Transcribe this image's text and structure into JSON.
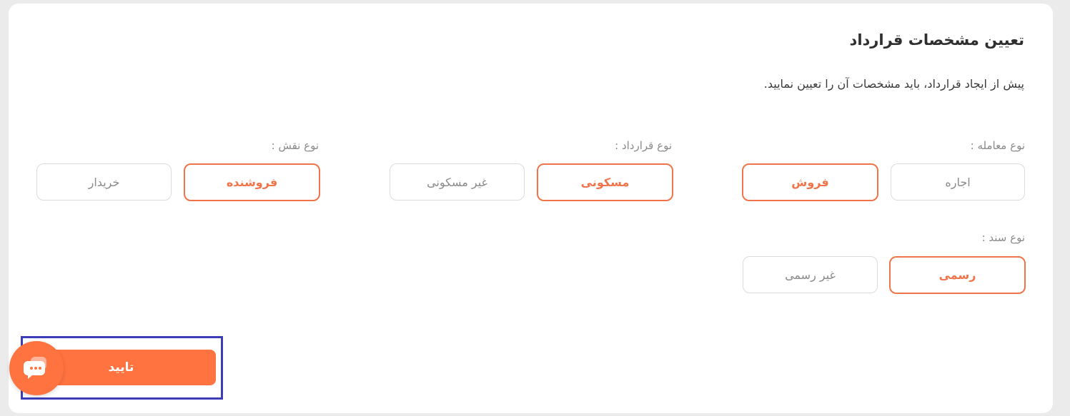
{
  "title": "تعیین مشخصات قرارداد",
  "description": "پیش از ایجاد قرارداد، باید مشخصات آن را تعیین نمایید.",
  "deal_type": {
    "label": "نوع معامله :",
    "options": [
      "اجاره",
      "فروش"
    ],
    "selected": "فروش"
  },
  "contract_type": {
    "label": "نوع قرارداد :",
    "options": [
      "غیر مسکونی",
      "مسکونی"
    ],
    "selected": "مسکونی"
  },
  "role_type": {
    "label": "نوع نقش :",
    "options": [
      "خریدار",
      "فروشنده"
    ],
    "selected": "فروشنده"
  },
  "document_type": {
    "label": "نوع سند :",
    "options": [
      "غیر رسمی",
      "رسمی"
    ],
    "selected": "رسمی"
  },
  "confirm_label": "تایید",
  "colors": {
    "accent": "#ff7340",
    "selected_border": "#f0744a",
    "highlight_frame": "#3d3db8"
  },
  "icons": {
    "chat": "chat-bubble-icon"
  }
}
